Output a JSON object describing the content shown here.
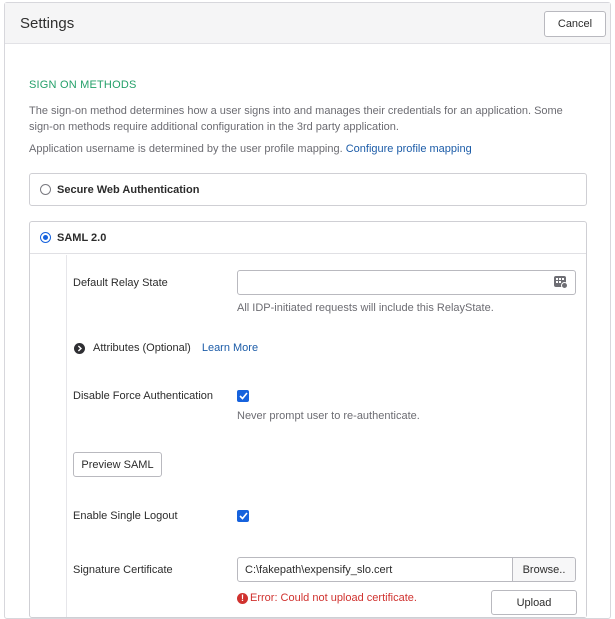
{
  "header": {
    "title": "Settings",
    "cancel_label": "Cancel"
  },
  "section": {
    "title": "SIGN ON METHODS",
    "description": "The sign-on method determines how a user signs into and manages their credentials for an application. Some sign-on methods require additional configuration in the 3rd party application.",
    "username_text": "Application username is determined by the user profile mapping.",
    "username_link": "Configure profile mapping"
  },
  "options": [
    {
      "label": "Secure Web Authentication",
      "selected": false
    },
    {
      "label": "SAML 2.0",
      "selected": true
    }
  ],
  "saml": {
    "relay_state_label": "Default Relay State",
    "relay_state_value": "",
    "relay_state_hint": "All IDP-initiated requests will include this RelayState.",
    "attributes_label": "Attributes (Optional)",
    "learn_more": "Learn More",
    "disable_force_label": "Disable Force Authentication",
    "disable_force_checked": true,
    "disable_force_hint": "Never prompt user to re-authenticate.",
    "preview_label": "Preview SAML",
    "single_logout_label": "Enable Single Logout",
    "single_logout_checked": true,
    "signature_label": "Signature Certificate",
    "signature_value": "C:\\fakepath\\expensify_slo.cert",
    "browse_label": "Browse..",
    "error_text": "Error: Could not upload certificate.",
    "upload_label": "Upload"
  },
  "colors": {
    "accent": "#1662dd",
    "section_title": "#24a069",
    "link": "#1c5ca8",
    "error": "#d0322f"
  },
  "icons": {
    "relay_field": "keypad-icon",
    "attributes_toggle": "chevron-right-circle-icon",
    "checkbox": "checkmark-icon",
    "error": "error-icon"
  }
}
